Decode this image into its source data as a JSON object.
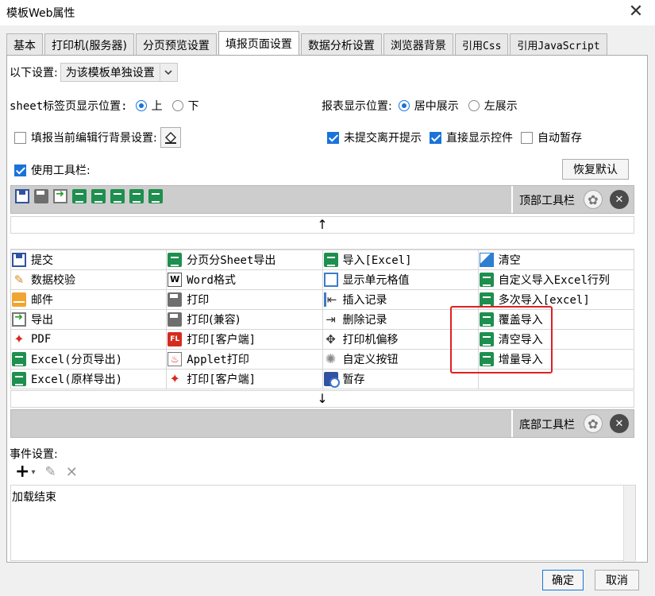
{
  "window": {
    "title": "模板Web属性"
  },
  "tabs": [
    {
      "label": "基本",
      "active": false
    },
    {
      "label": "打印机(服务器)",
      "active": false
    },
    {
      "label": "分页预览设置",
      "active": false
    },
    {
      "label": "填报页面设置",
      "active": true
    },
    {
      "label": "数据分析设置",
      "active": false
    },
    {
      "label": "浏览器背景",
      "active": false
    },
    {
      "label": "引用Css",
      "active": false
    },
    {
      "label": "引用JavaScript",
      "active": false
    }
  ],
  "settings": {
    "scope_label": "以下设置:",
    "scope_value": "为该模板单独设置",
    "sheet_pos_label": "sheet标签页显示位置:",
    "sheet_pos_options": [
      "上",
      "下"
    ],
    "sheet_pos_selected": "上",
    "report_pos_label": "报表显示位置:",
    "report_pos_options": [
      "居中展示",
      "左展示"
    ],
    "report_pos_selected": "居中展示",
    "fill_bg_label": "填报当前编辑行背景设置:",
    "fill_bg_checked": false,
    "leave_prompt_label": "未提交离开提示",
    "leave_prompt_checked": true,
    "direct_show_label": "直接显示控件",
    "direct_show_checked": true,
    "autosave_label": "自动暂存",
    "autosave_checked": false,
    "use_toolbar_label": "使用工具栏:",
    "use_toolbar_checked": true,
    "restore_label": "恢复默认"
  },
  "top_toolbar": {
    "label": "顶部工具栏",
    "icons": [
      "save-icon",
      "print-icon",
      "export-icon",
      "excel-icon",
      "excel-icon",
      "excel-icon",
      "excel-icon",
      "excel-icon"
    ]
  },
  "bottom_toolbar": {
    "label": "底部工具栏"
  },
  "arrows": {
    "up": "↑",
    "down": "↓"
  },
  "buttons_grid": [
    [
      {
        "label": "提交",
        "icon": "submit-icon"
      },
      {
        "label": "分页分Sheet导出",
        "icon": "excel-icon"
      },
      {
        "label": "导入[Excel]",
        "icon": "excel-icon"
      },
      {
        "label": "清空",
        "icon": "eraser-icon"
      }
    ],
    [
      {
        "label": "数据校验",
        "icon": "wand-icon"
      },
      {
        "label": "Word格式",
        "icon": "word-icon"
      },
      {
        "label": "显示单元格值",
        "icon": "cell-icon"
      },
      {
        "label": "自定义导入Excel行列",
        "icon": "excel-icon"
      }
    ],
    [
      {
        "label": "邮件",
        "icon": "mail-icon"
      },
      {
        "label": "打印",
        "icon": "print-icon"
      },
      {
        "label": "插入记录",
        "icon": "insert-row-icon"
      },
      {
        "label": "多次导入[excel]",
        "icon": "excel-icon"
      }
    ],
    [
      {
        "label": "导出",
        "icon": "export-icon"
      },
      {
        "label": "打印(兼容)",
        "icon": "print-icon"
      },
      {
        "label": "删除记录",
        "icon": "delete-row-icon"
      },
      {
        "label": "覆盖导入",
        "icon": "excel-icon"
      }
    ],
    [
      {
        "label": "PDF",
        "icon": "pdf-icon"
      },
      {
        "label": "打印[客户端]",
        "icon": "flash-print-icon"
      },
      {
        "label": "打印机偏移",
        "icon": "move-icon"
      },
      {
        "label": "清空导入",
        "icon": "excel-icon"
      }
    ],
    [
      {
        "label": "Excel(分页导出)",
        "icon": "excel-icon"
      },
      {
        "label": "Applet打印",
        "icon": "applet-icon"
      },
      {
        "label": "自定义按钮",
        "icon": "gear-icon"
      },
      {
        "label": "增量导入",
        "icon": "excel-icon"
      }
    ],
    [
      {
        "label": "Excel(原样导出)",
        "icon": "excel-icon"
      },
      {
        "label": "打印[客户端]",
        "icon": "pdf-icon"
      },
      {
        "label": "暂存",
        "icon": "temp-save-icon"
      },
      {
        "label": "",
        "icon": ""
      }
    ]
  ],
  "events": {
    "label": "事件设置:",
    "items": [
      "加载结束"
    ]
  },
  "footer": {
    "ok_label": "确定",
    "cancel_label": "取消"
  },
  "colors": {
    "accent": "#1a73d9",
    "highlight": "#e02020",
    "toolbar_bar": "#cdcdcd"
  }
}
